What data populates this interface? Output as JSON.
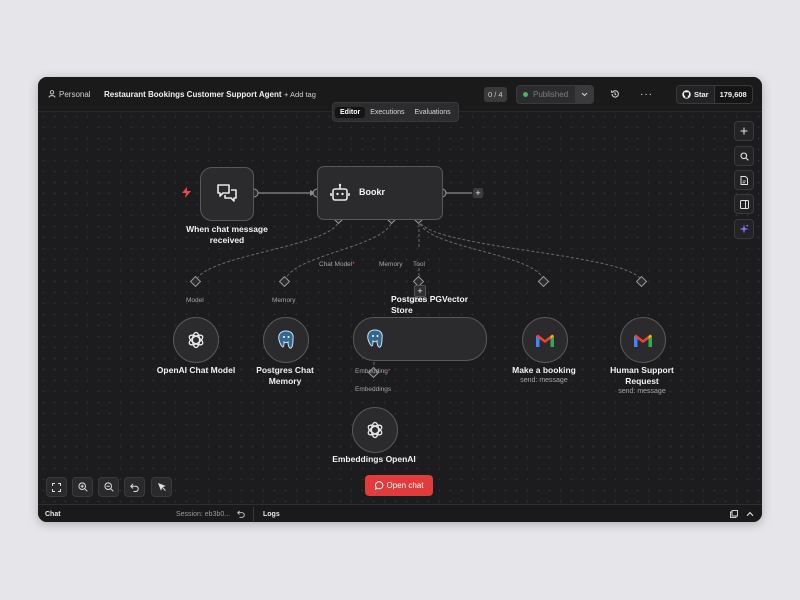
{
  "topbar": {
    "project": "Personal",
    "workflow_name": "Restaurant Bookings Customer Support Agent",
    "add_tag": "+ Add tag",
    "counter": "0 / 4",
    "status": "Published",
    "github_star": "Star",
    "github_count": "179,608"
  },
  "tabs": [
    {
      "label": "Editor",
      "active": true
    },
    {
      "label": "Executions",
      "active": false
    },
    {
      "label": "Evaluations",
      "active": false
    }
  ],
  "nodes": {
    "trigger": {
      "label_line1": "When chat message",
      "label_line2": "received",
      "icon": "chat-bubbles-icon"
    },
    "agent": {
      "title": "Bookr",
      "icon": "robot-icon"
    },
    "openai_chat": {
      "label": "OpenAI Chat Model",
      "icon": "openai-icon"
    },
    "pg_memory": {
      "label_line1": "Postgres Chat",
      "label_line2": "Memory",
      "icon": "postgres-icon"
    },
    "pg_vector": {
      "label_line1": "Postgres PGVector",
      "label_line2": "Store",
      "icon": "postgres-icon"
    },
    "booking": {
      "label": "Make a booking",
      "sub": "send: message",
      "icon": "gmail-icon"
    },
    "human": {
      "label_line1": "Human Support",
      "label_line2": "Request",
      "sub": "send: message",
      "icon": "gmail-icon"
    },
    "embeddings": {
      "label": "Embeddings OpenAI",
      "icon": "openai-icon"
    }
  },
  "connectors": {
    "chat_model": "Chat Model",
    "memory": "Memory",
    "tool": "Tool",
    "model": "Model",
    "memory2": "Memory",
    "tool2": "Tool",
    "embedding": "Embedding",
    "embeddings": "Embeddings",
    "required_mark": "*"
  },
  "open_chat": "Open chat",
  "bottombar": {
    "chat": "Chat",
    "session": "Session: eb3b0...",
    "logs": "Logs"
  },
  "colors": {
    "accent": "#e23b3b",
    "published_dot": "#3fb95a",
    "assist": "#8b6cf0"
  }
}
